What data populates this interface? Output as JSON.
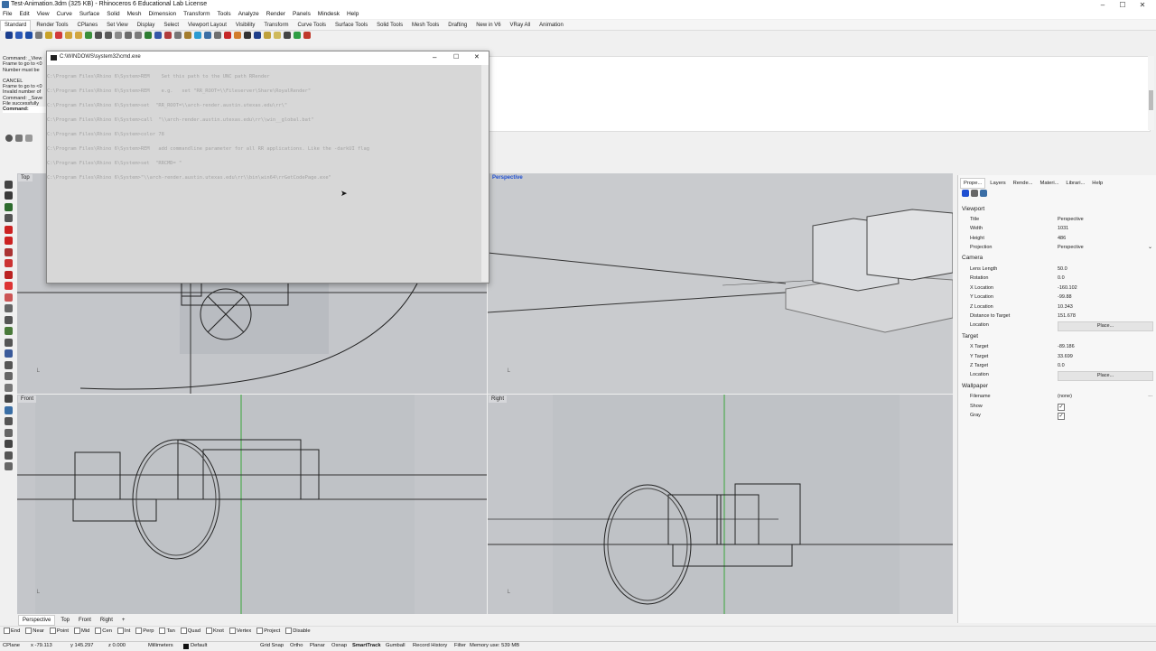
{
  "window": {
    "title": "Test-Animation.3dm (325 KB) - Rhinoceros 6 Educational Lab License",
    "controls": {
      "minimize": "–",
      "maximize": "☐",
      "close": "✕"
    }
  },
  "menu": [
    "File",
    "Edit",
    "View",
    "Curve",
    "Surface",
    "Solid",
    "Mesh",
    "Dimension",
    "Transform",
    "Tools",
    "Analyze",
    "Render",
    "Panels",
    "Mindesk",
    "Help"
  ],
  "toolbar_tabs": [
    "Standard",
    "Render Tools",
    "CPlanes",
    "Set View",
    "Display",
    "Select",
    "Viewport Layout",
    "Visibility",
    "Transform",
    "Curve Tools",
    "Surface Tools",
    "Solid Tools",
    "Mesh Tools",
    "Drafting",
    "New in V6",
    "VRay All",
    "Animation"
  ],
  "command_history": [
    "Command: _View",
    "Frame to go to <0",
    "Number must be",
    "",
    "CANCEL",
    "Frame to go to <0",
    "Invalid number of",
    "Command: _Save",
    "File successfully",
    "Command:"
  ],
  "cmd_window": {
    "title": "C:\\WINDOWS\\system32\\cmd.exe",
    "lines": [
      "C:\\Program Files\\Rhino 6\\System>REM    Set this path to the UNC path RRender",
      "C:\\Program Files\\Rhino 6\\System>REM    e.g.   set \"RR_ROOT=\\\\Fileserver\\Share\\RoyalRender\"",
      "C:\\Program Files\\Rhino 6\\System>set  \"RR_ROOT=\\\\arch-render.austin.utexas.edu\\rr\\\"",
      "C:\\Program Files\\Rhino 6\\System>call  \"\\\\arch-render.austin.utexas.edu\\rr\\\\win__global.bat\"",
      "C:\\Program Files\\Rhino 6\\System>color 78",
      "C:\\Program Files\\Rhino 6\\System>REM   add commandline parameter for all RR applications. Like the -darkUI flag",
      "C:\\Program Files\\Rhino 6\\System>set  \"RRCMD= \"",
      "C:\\Program Files\\Rhino 6\\System>\"\\\\arch-render.austin.utexas.edu\\rr\\\\bin\\win64\\rrGetCodePage.exe\""
    ]
  },
  "viewports": {
    "top": "Top",
    "perspective": "Perspective",
    "front": "Front",
    "right": "Right"
  },
  "properties": {
    "tabs": [
      "Prope...",
      "Layers",
      "Rende...",
      "Materi...",
      "Librari...",
      "Help"
    ],
    "sections": {
      "viewport": "Viewport",
      "camera": "Camera",
      "target": "Target",
      "wallpaper": "Wallpaper"
    },
    "viewport_rows": [
      {
        "label": "Title",
        "value": "Perspective"
      },
      {
        "label": "Width",
        "value": "1031"
      },
      {
        "label": "Height",
        "value": "486"
      },
      {
        "label": "Projection",
        "value": "Perspective"
      }
    ],
    "camera_rows": [
      {
        "label": "Lens Length",
        "value": "50.0"
      },
      {
        "label": "Rotation",
        "value": "0.0"
      },
      {
        "label": "X Location",
        "value": "-160.102"
      },
      {
        "label": "Y Location",
        "value": "-99.88"
      },
      {
        "label": "Z Location",
        "value": "10.343"
      },
      {
        "label": "Distance to Target",
        "value": "151.678"
      },
      {
        "label": "Location",
        "value": "Place..."
      }
    ],
    "target_rows": [
      {
        "label": "X Target",
        "value": "-89.186"
      },
      {
        "label": "Y Target",
        "value": "33.699"
      },
      {
        "label": "Z Target",
        "value": "0.0"
      },
      {
        "label": "Location",
        "value": "Place..."
      }
    ],
    "wallpaper_rows": [
      {
        "label": "Filename",
        "value": "(none)"
      },
      {
        "label": "Show",
        "value": "✓"
      },
      {
        "label": "Gray",
        "value": "✓"
      }
    ]
  },
  "viewport_tabs": [
    "Perspective",
    "Top",
    "Front",
    "Right",
    "+"
  ],
  "osnaps": [
    "End",
    "Near",
    "Point",
    "Mid",
    "Cen",
    "Int",
    "Perp",
    "Tan",
    "Quad",
    "Knot",
    "Vertex",
    "Project",
    "Disable"
  ],
  "status": {
    "cplane": "CPlane",
    "x": "x -79.113",
    "y": "y 145.297",
    "z": "z 0.000",
    "units": "Millimeters",
    "layer": "Default",
    "grid_snap": "Grid Snap",
    "ortho": "Ortho",
    "planar": "Planar",
    "osnap": "Osnap",
    "smarttrack": "SmartTrack",
    "gumball": "Gumball",
    "record_history": "Record History",
    "filter": "Filter",
    "memory": "Memory use: 539 MB"
  }
}
